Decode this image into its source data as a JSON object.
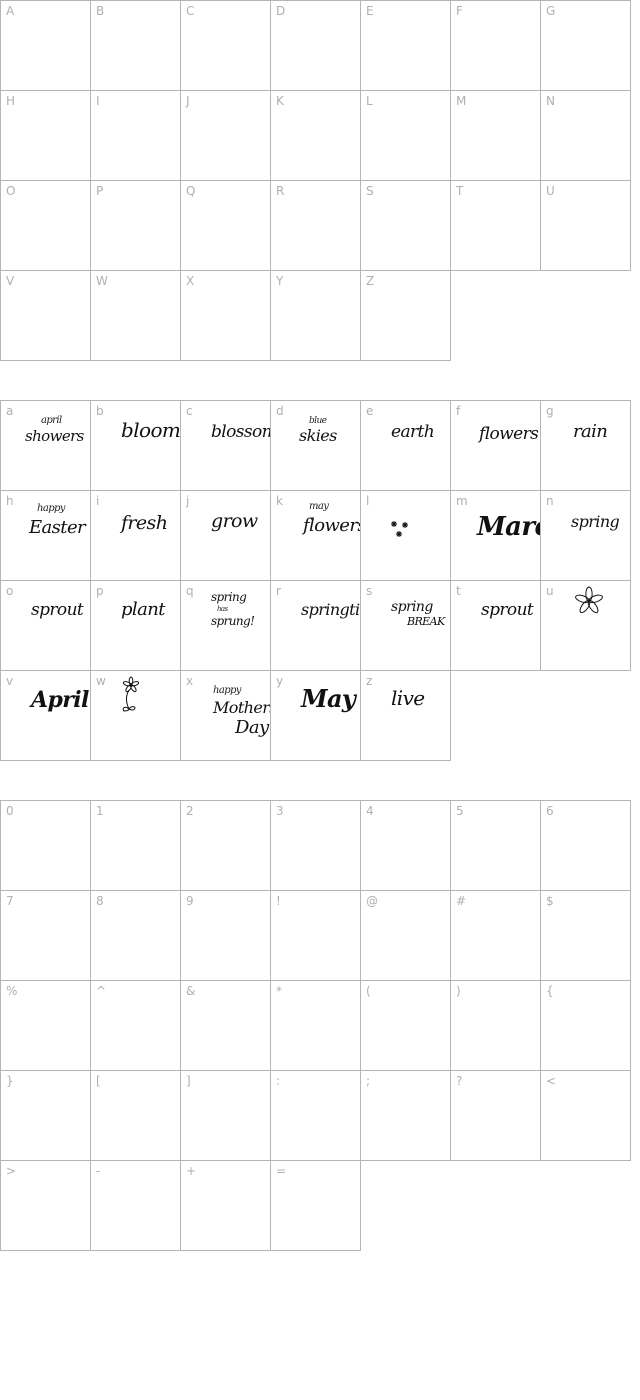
{
  "sections": [
    {
      "id": "uppercase",
      "cells": [
        {
          "label": "A"
        },
        {
          "label": "B"
        },
        {
          "label": "C"
        },
        {
          "label": "D"
        },
        {
          "label": "E"
        },
        {
          "label": "F"
        },
        {
          "label": "G"
        },
        {
          "label": "H"
        },
        {
          "label": "I"
        },
        {
          "label": "J"
        },
        {
          "label": "K"
        },
        {
          "label": "L"
        },
        {
          "label": "M"
        },
        {
          "label": "N"
        },
        {
          "label": "O"
        },
        {
          "label": "P"
        },
        {
          "label": "Q"
        },
        {
          "label": "R"
        },
        {
          "label": "S"
        },
        {
          "label": "T"
        },
        {
          "label": "U"
        },
        {
          "label": "V"
        },
        {
          "label": "W"
        },
        {
          "label": "X"
        },
        {
          "label": "Y"
        },
        {
          "label": "Z"
        }
      ]
    },
    {
      "id": "lowercase",
      "cells": [
        {
          "label": "a",
          "glyph": {
            "type": "words",
            "lines": [
              "april",
              "showers"
            ]
          }
        },
        {
          "label": "b",
          "glyph": {
            "type": "words",
            "lines": [
              "bloom"
            ]
          }
        },
        {
          "label": "c",
          "glyph": {
            "type": "words",
            "lines": [
              "blossom"
            ]
          }
        },
        {
          "label": "d",
          "glyph": {
            "type": "words",
            "lines": [
              "blue",
              "skies"
            ]
          }
        },
        {
          "label": "e",
          "glyph": {
            "type": "words",
            "lines": [
              "earth"
            ]
          }
        },
        {
          "label": "f",
          "glyph": {
            "type": "words",
            "lines": [
              "flowers"
            ]
          }
        },
        {
          "label": "g",
          "glyph": {
            "type": "words",
            "lines": [
              "rain"
            ]
          }
        },
        {
          "label": "h",
          "glyph": {
            "type": "words",
            "lines": [
              "happy",
              "Easter"
            ]
          }
        },
        {
          "label": "i",
          "glyph": {
            "type": "words",
            "lines": [
              "fresh"
            ]
          }
        },
        {
          "label": "j",
          "glyph": {
            "type": "words",
            "lines": [
              "grow"
            ]
          }
        },
        {
          "label": "k",
          "glyph": {
            "type": "words",
            "lines": [
              "may",
              "flowers"
            ]
          }
        },
        {
          "label": "l",
          "glyph": {
            "type": "stars"
          }
        },
        {
          "label": "m",
          "glyph": {
            "type": "words",
            "lines": [
              "March"
            ],
            "style": "big"
          }
        },
        {
          "label": "n",
          "glyph": {
            "type": "words",
            "lines": [
              "spring"
            ]
          }
        },
        {
          "label": "o",
          "glyph": {
            "type": "words",
            "lines": [
              "sprout"
            ]
          }
        },
        {
          "label": "p",
          "glyph": {
            "type": "words",
            "lines": [
              "plant"
            ]
          }
        },
        {
          "label": "q",
          "glyph": {
            "type": "words",
            "lines": [
              "spring",
              "has",
              "sprung!"
            ]
          }
        },
        {
          "label": "r",
          "glyph": {
            "type": "words",
            "lines": [
              "springtime"
            ]
          }
        },
        {
          "label": "s",
          "glyph": {
            "type": "words",
            "lines": [
              "spring",
              "BREAK"
            ]
          }
        },
        {
          "label": "t",
          "glyph": {
            "type": "words",
            "lines": [
              "sprout"
            ]
          }
        },
        {
          "label": "u",
          "glyph": {
            "type": "flower"
          }
        },
        {
          "label": "v",
          "glyph": {
            "type": "words",
            "lines": [
              "April"
            ],
            "style": "bold"
          }
        },
        {
          "label": "w",
          "glyph": {
            "type": "stem-flower"
          }
        },
        {
          "label": "x",
          "glyph": {
            "type": "words",
            "lines": [
              "happy",
              "Mothers",
              "Day"
            ]
          }
        },
        {
          "label": "y",
          "glyph": {
            "type": "words",
            "lines": [
              "May"
            ],
            "style": "bold"
          }
        },
        {
          "label": "z",
          "glyph": {
            "type": "words",
            "lines": [
              "live"
            ]
          }
        }
      ]
    },
    {
      "id": "symbols",
      "cells": [
        {
          "label": "0"
        },
        {
          "label": "1"
        },
        {
          "label": "2"
        },
        {
          "label": "3"
        },
        {
          "label": "4"
        },
        {
          "label": "5"
        },
        {
          "label": "6"
        },
        {
          "label": "7"
        },
        {
          "label": "8"
        },
        {
          "label": "9"
        },
        {
          "label": "!"
        },
        {
          "label": "@"
        },
        {
          "label": "#"
        },
        {
          "label": "$"
        },
        {
          "label": "%"
        },
        {
          "label": "^"
        },
        {
          "label": "&"
        },
        {
          "label": "*"
        },
        {
          "label": "("
        },
        {
          "label": ")"
        },
        {
          "label": "{"
        },
        {
          "label": "}"
        },
        {
          "label": "["
        },
        {
          "label": "]"
        },
        {
          "label": ":"
        },
        {
          "label": ";"
        },
        {
          "label": "?"
        },
        {
          "label": "<"
        },
        {
          "label": ">"
        },
        {
          "label": "-"
        },
        {
          "label": "+"
        },
        {
          "label": "="
        }
      ]
    }
  ]
}
